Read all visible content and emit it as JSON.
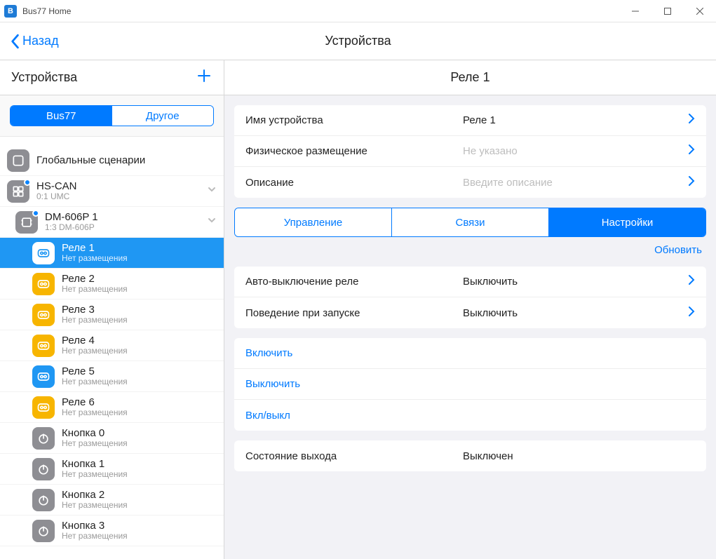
{
  "window": {
    "title": "Bus77 Home"
  },
  "navbar": {
    "back": "Назад",
    "title": "Устройства"
  },
  "sidebar": {
    "title": "Устройства",
    "segments": {
      "bus77": "Bus77",
      "other": "Другое"
    },
    "items": {
      "global_scen": "Глобальные сценарии",
      "hs_can": {
        "title": "HS-CAN",
        "sub": "0:1 UMC"
      },
      "dm606": {
        "title": "DM-606P 1",
        "sub": "1:3 DM-606P"
      },
      "relays": [
        {
          "title": "Реле 1",
          "sub": "Нет размещения"
        },
        {
          "title": "Реле 2",
          "sub": "Нет размещения"
        },
        {
          "title": "Реле 3",
          "sub": "Нет размещения"
        },
        {
          "title": "Реле 4",
          "sub": "Нет размещения"
        },
        {
          "title": "Реле 5",
          "sub": "Нет размещения"
        },
        {
          "title": "Реле 6",
          "sub": "Нет размещения"
        }
      ],
      "buttons": [
        {
          "title": "Кнопка 0",
          "sub": "Нет размещения"
        },
        {
          "title": "Кнопка 1",
          "sub": "Нет размещения"
        },
        {
          "title": "Кнопка 2",
          "sub": "Нет размещения"
        },
        {
          "title": "Кнопка 3",
          "sub": "Нет размещения"
        }
      ]
    }
  },
  "detail": {
    "title": "Реле 1",
    "info": {
      "name_label": "Имя устройства",
      "name_value": "Реле 1",
      "placement_label": "Физическое размещение",
      "placement_placeholder": "Не указано",
      "desc_label": "Описание",
      "desc_placeholder": "Введите описание"
    },
    "tabs": {
      "control": "Управление",
      "links": "Связи",
      "settings": "Настройки"
    },
    "refresh": "Обновить",
    "settings": {
      "auto_off_label": "Авто-выключение реле",
      "auto_off_value": "Выключить",
      "startup_label": "Поведение при запуске",
      "startup_value": "Выключить"
    },
    "actions": {
      "on": "Включить",
      "off": "Выключить",
      "toggle": "Вкл/выкл"
    },
    "state": {
      "label": "Состояние выхода",
      "value": "Выключен"
    }
  }
}
